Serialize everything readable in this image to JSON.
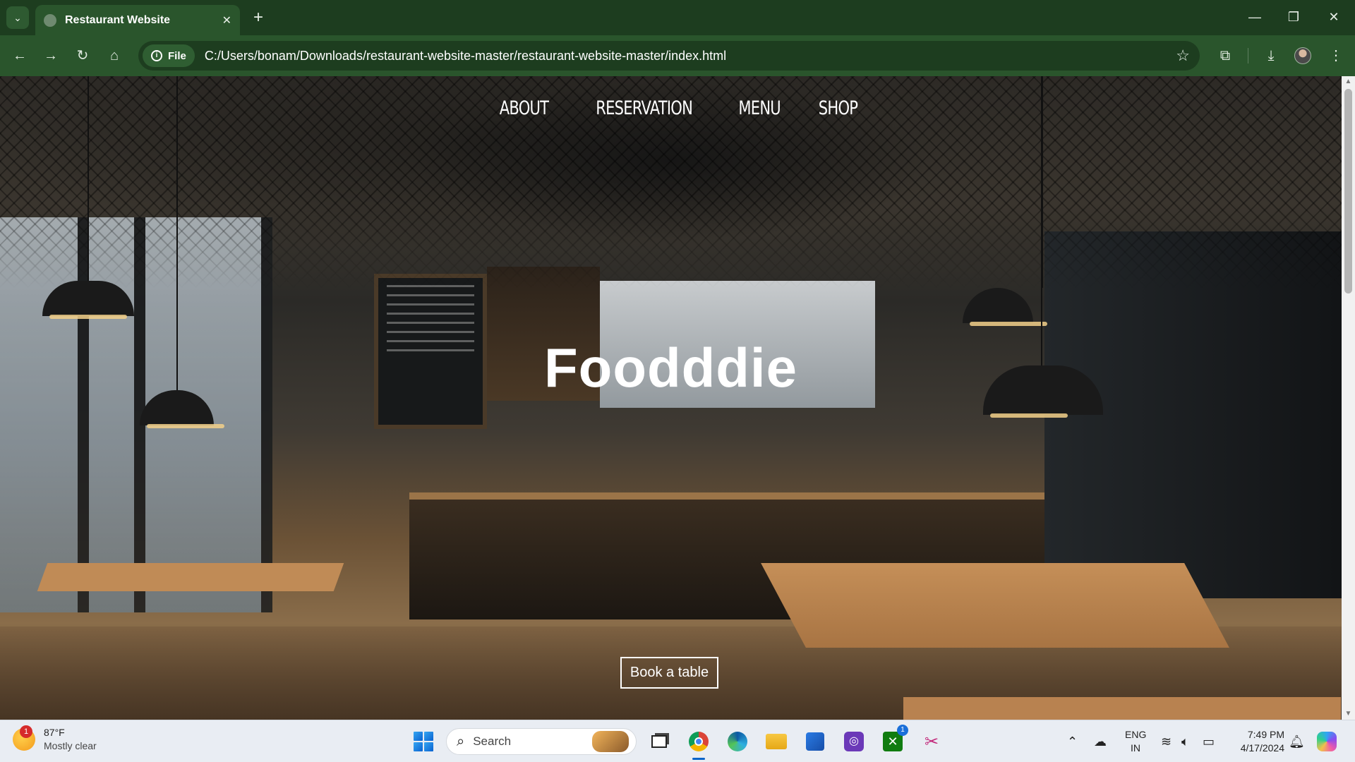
{
  "browser": {
    "tab_title": "Restaurant Website",
    "tab_close": "✕",
    "new_tab": "+",
    "site_info_label": "File",
    "url": "C:/Users/bonam/Downloads/restaurant-website-master/restaurant-website-master/index.html",
    "accent_color": "#2a552c"
  },
  "page": {
    "nav": [
      {
        "label": "ABOUT"
      },
      {
        "label": "RESERVATION"
      },
      {
        "label": "MENU"
      },
      {
        "label": "SHOP"
      }
    ],
    "hero_title": "Foodddie",
    "cta_label": "Book a table"
  },
  "taskbar": {
    "weather": {
      "temp": "87°F",
      "condition": "Mostly clear",
      "badge": "1"
    },
    "search_label": "Search",
    "apps": [
      {
        "name": "task-view-icon"
      },
      {
        "name": "chrome-icon",
        "active": true
      },
      {
        "name": "edge-icon"
      },
      {
        "name": "file-explorer-icon"
      },
      {
        "name": "microsoft-store-icon"
      },
      {
        "name": "app-icon"
      },
      {
        "name": "xbox-icon",
        "badge": "1"
      },
      {
        "name": "snipping-tool-icon"
      }
    ],
    "language": {
      "line1": "ENG",
      "line2": "IN"
    },
    "clock": {
      "time": "7:49 PM",
      "date": "4/17/2024"
    }
  }
}
